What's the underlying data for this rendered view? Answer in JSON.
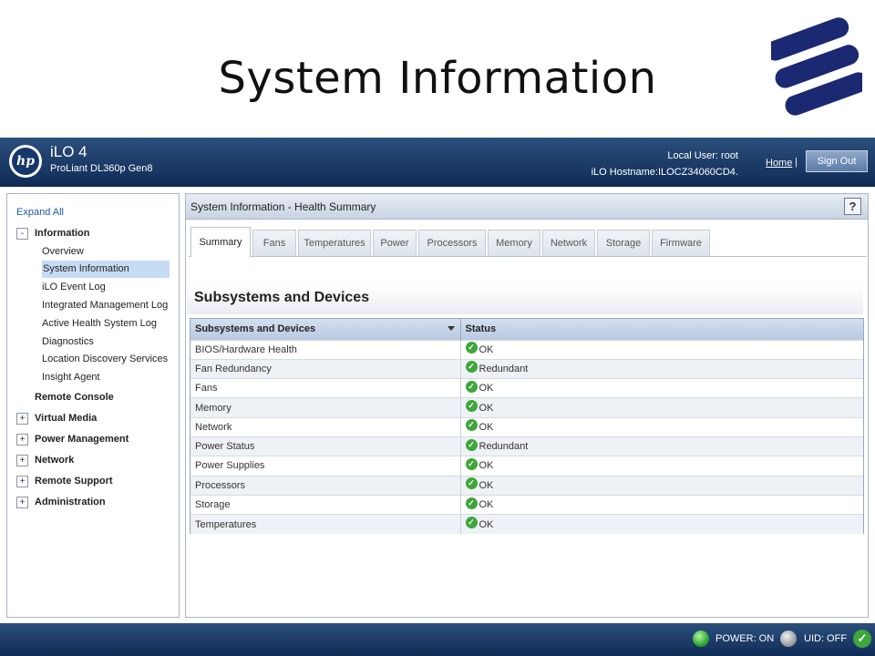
{
  "slide": {
    "title": "System Information"
  },
  "colors": {
    "header_blue": "#1a3a6b",
    "ok_green": "#3fa63a",
    "selected_nav": "#c6dcf5",
    "logo_navy": "#1b2872"
  },
  "header": {
    "product": "iLO 4",
    "server_model": "ProLiant DL360p Gen8",
    "user_line": "Local User:  root",
    "hostname_line": "iLO Hostname:ILOCZ34060CD4.",
    "home_label": "Home",
    "separator": "|",
    "sign_out_label": "Sign Out"
  },
  "sidebar": {
    "expand_all": "Expand All",
    "information": {
      "label": "Information",
      "toggle": "-",
      "items": [
        "Overview",
        "System Information",
        "iLO Event Log",
        "Integrated Management Log",
        "Active Health System Log",
        "Diagnostics",
        "Location Discovery Services",
        "Insight Agent"
      ],
      "selected": "System Information"
    },
    "remote_console": "Remote Console",
    "groups": [
      {
        "label": "Virtual Media",
        "toggle": "+"
      },
      {
        "label": "Power Management",
        "toggle": "+"
      },
      {
        "label": "Network",
        "toggle": "+"
      },
      {
        "label": "Remote Support",
        "toggle": "+"
      },
      {
        "label": "Administration",
        "toggle": "+"
      }
    ]
  },
  "content": {
    "title": "System Information - Health Summary",
    "help": "?",
    "tabs": [
      "Summary",
      "Fans",
      "Temperatures",
      "Power",
      "Processors",
      "Memory",
      "Network",
      "Storage",
      "Firmware"
    ],
    "active_tab": "Summary",
    "section_title": "Subsystems and Devices",
    "table": {
      "columns": [
        "Subsystems and Devices",
        "Status"
      ],
      "rows": [
        {
          "name": "BIOS/Hardware Health",
          "status": "OK"
        },
        {
          "name": "Fan Redundancy",
          "status": "Redundant"
        },
        {
          "name": "Fans",
          "status": "OK"
        },
        {
          "name": "Memory",
          "status": "OK"
        },
        {
          "name": "Network",
          "status": "OK"
        },
        {
          "name": "Power Status",
          "status": "Redundant"
        },
        {
          "name": "Power Supplies",
          "status": "OK"
        },
        {
          "name": "Processors",
          "status": "OK"
        },
        {
          "name": "Storage",
          "status": "OK"
        },
        {
          "name": "Temperatures",
          "status": "OK"
        }
      ]
    }
  },
  "footer": {
    "power_status": "POWER: ON",
    "uid_status": "UID: OFF",
    "power_led": "green-led-icon",
    "uid_led": "gray-led-icon",
    "health_icon": "check-icon"
  }
}
